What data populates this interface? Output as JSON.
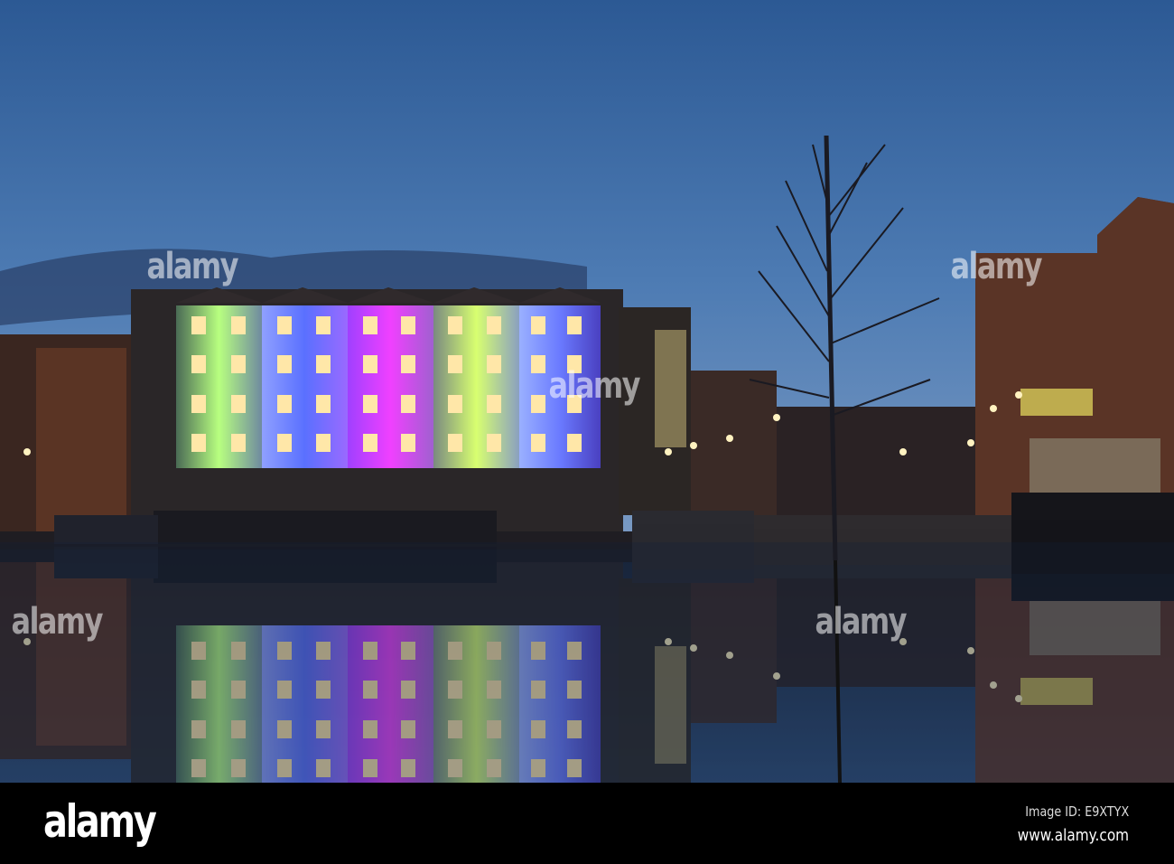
{
  "footer": {
    "logo": "alamy",
    "image_id": "Image ID: E9XTYX",
    "website": "www.alamy.com"
  },
  "watermark": "alamy",
  "colors": {
    "sky_top": "#2f5f9c",
    "sky_horizon": "#6f93bf",
    "water": "#16243d",
    "light_green": "#9bff6a",
    "light_blue": "#7f8cff",
    "light_magenta": "#e23cff",
    "light_yellow": "#f2ff7a"
  }
}
